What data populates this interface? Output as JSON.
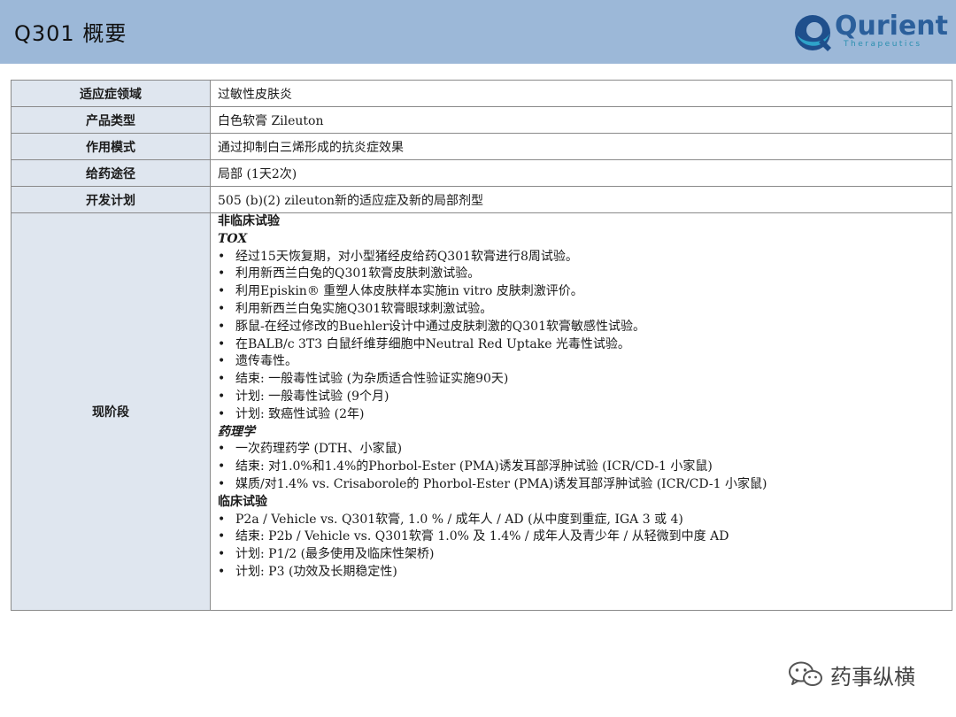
{
  "header": {
    "title": "Q301 概要",
    "logo": {
      "name": "Qurient",
      "tagline": "Therapeutics"
    }
  },
  "rows": [
    {
      "label": "适应症领域",
      "value": "过敏性皮肤炎"
    },
    {
      "label": "产品类型",
      "value": "白色软膏 Zileuton"
    },
    {
      "label": "作用模式",
      "value": "通过抑制白三烯形成的抗炎症效果"
    },
    {
      "label": "给药途径",
      "value": "局部 (1天2次)"
    },
    {
      "label": "开发计划",
      "value": "505 (b)(2) zileuton新的适应症及新的局部剂型"
    }
  ],
  "stage": {
    "label": "现阶段",
    "nonclinical_heading": "非临床试验",
    "tox_heading": "TOX",
    "tox_items": [
      "经过15天恢复期，对小型猪经皮给药Q301软膏进行8周试验。",
      "利用新西兰白兔的Q301软膏皮肤刺激试验。",
      "利用Episkin® 重塑人体皮肤样本实施in vitro 皮肤刺激评价。",
      "利用新西兰白兔实施Q301软膏眼球刺激试验。",
      "豚鼠-在经过修改的Buehler设计中通过皮肤刺激的Q301软膏敏感性试验。",
      "在BALB/c 3T3 白鼠纤维芽细胞中Neutral Red Uptake 光毒性试验。",
      "遗传毒性。",
      "结束: 一般毒性试验 (为杂质适合性验证实施90天)",
      "计划: 一般毒性试验 (9个月)",
      "计划: 致癌性试验 (2年)"
    ],
    "pharm_heading": "药理学",
    "pharm_items": [
      "一次药理药学 (DTH、小家鼠)",
      "结束: 对1.0%和1.4%的Phorbol-Ester (PMA)诱发耳部浮肿试验 (ICR/CD-1 小家鼠)",
      "媒质/对1.4% vs. Crisaborole的 Phorbol-Ester (PMA)诱发耳部浮肿试验 (ICR/CD-1 小家鼠)"
    ],
    "clinical_heading": "临床试验",
    "clinical_items": [
      "P2a / Vehicle vs. Q301软膏, 1.0 % / 成年人 / AD (从中度到重症, IGA 3 或 4)",
      "结束: P2b / Vehicle vs. Q301软膏 1.0% 及 1.4% / 成年人及青少年 / 从轻微到中度 AD",
      "计划: P1/2 (最多使用及临床性架桥)",
      "计划: P3 (功效及长期稳定性)"
    ]
  },
  "watermark": {
    "text": "药事纵横",
    "icon": "wechat-icon"
  },
  "colors": {
    "header_bg": "#9cb8d8",
    "label_bg": "#dfe6ef",
    "logo_blue": "#2b5f9b"
  }
}
